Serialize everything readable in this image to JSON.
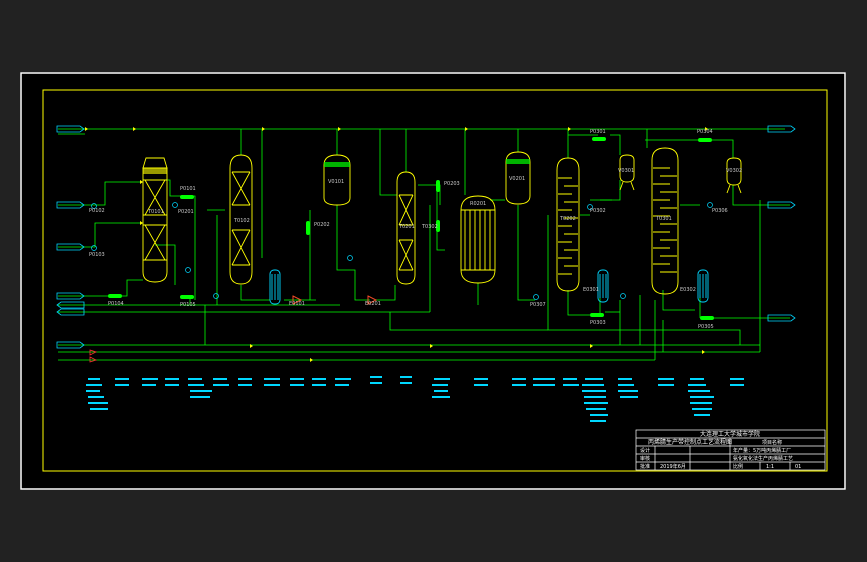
{
  "drawing": {
    "colors": {
      "background": "#222222",
      "paper": "#000000",
      "frame": "#ffffff",
      "inner_border": "#ffff00",
      "equipment": "#ffff00",
      "process_line": "#00ff00",
      "instrument": "#00d8ff",
      "text": "#c8c8c8"
    },
    "equipment_tags": {
      "t0101": "T0101",
      "t0102": "T0102",
      "t0201": "T0201",
      "t0202": "T0202",
      "t0301": "T0301",
      "t0302": "T0302",
      "r0201": "R0201",
      "v0101": "V0101",
      "v0201": "V0201",
      "v0301": "V0301",
      "v0302": "V0302",
      "e0101": "E0101",
      "e0201": "E0201",
      "e0301": "E0301",
      "e0302": "E0302"
    },
    "pump_tags": {
      "p0101": "P0101",
      "p0102": "P0102",
      "p0103": "P0103",
      "p0104": "P0104",
      "p0105": "P0105",
      "p0201": "P0201",
      "p0202": "P0202",
      "p0203": "P0203",
      "p0301": "P0301",
      "p0302": "P0302",
      "p0303": "P0303",
      "p0304": "P0304",
      "p0305": "P0305",
      "p0306": "P0306",
      "p0307": "P0307"
    }
  },
  "title_block": {
    "school": "大连理工大学城市学院",
    "drawing_title": "丙烯腈生产带控制点工艺流程图",
    "project": "项目名称",
    "row_design": "设计",
    "row_check": "审核",
    "row_approve": "批准",
    "design_desc": "年产量：5万吨丙烯腈工厂",
    "process_desc": "氨化氧化法生产丙烯腈工艺",
    "scale_label": "比例",
    "scale_value": "1:1",
    "sheet_label": "图号",
    "sheet_value": "01",
    "date": "2019年6月"
  }
}
